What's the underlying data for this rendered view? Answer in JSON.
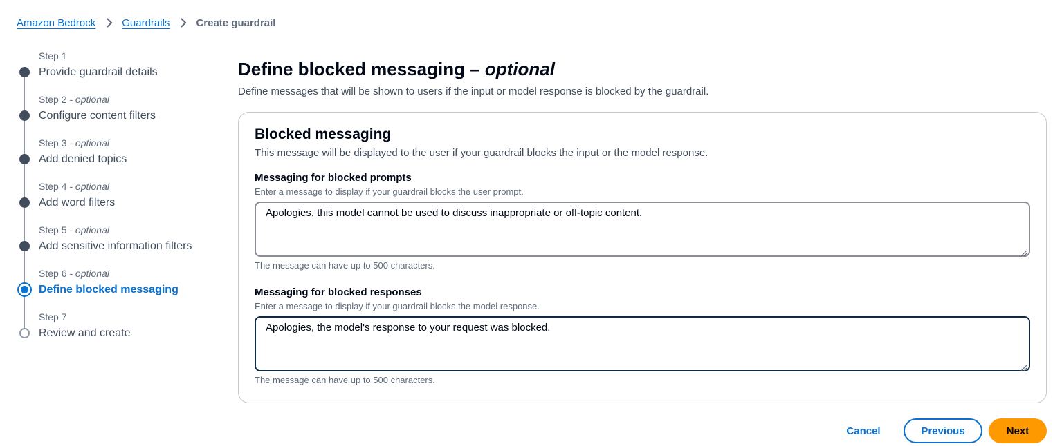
{
  "breadcrumb": {
    "items": [
      {
        "label": "Amazon Bedrock"
      },
      {
        "label": "Guardrails"
      }
    ],
    "current": "Create guardrail"
  },
  "steps": [
    {
      "number": "Step 1",
      "optional": "",
      "title": "Provide guardrail details",
      "state": "done"
    },
    {
      "number": "Step 2",
      "optional": " - optional",
      "title": "Configure content filters",
      "state": "done"
    },
    {
      "number": "Step 3",
      "optional": " - optional",
      "title": "Add denied topics",
      "state": "done"
    },
    {
      "number": "Step 4",
      "optional": " - optional",
      "title": "Add word filters",
      "state": "done"
    },
    {
      "number": "Step 5",
      "optional": " - optional",
      "title": "Add sensitive information filters",
      "state": "done"
    },
    {
      "number": "Step 6",
      "optional": " - optional",
      "title": "Define blocked messaging",
      "state": "active"
    },
    {
      "number": "Step 7",
      "optional": "",
      "title": "Review and create",
      "state": "todo"
    }
  ],
  "page": {
    "title": "Define blocked messaging",
    "title_dash": " – ",
    "title_optional": "optional",
    "description": "Define messages that will be shown to users if the input or model response is blocked by the guardrail."
  },
  "panel": {
    "title": "Blocked messaging",
    "description": "This message will be displayed to the user if your guardrail blocks the input or the model response.",
    "prompts": {
      "label": "Messaging for blocked prompts",
      "description": "Enter a message to display if your guardrail blocks the user prompt.",
      "value": "Apologies, this model cannot be used to discuss inappropriate or off-topic content.",
      "hint": "The message can have up to 500 characters."
    },
    "responses": {
      "label": "Messaging for blocked responses",
      "description": "Enter a message to display if your guardrail blocks the model response.",
      "value": "Apologies, the model's response to your request was blocked.",
      "hint": "The message can have up to 500 characters."
    }
  },
  "footer": {
    "cancel": "Cancel",
    "previous": "Previous",
    "next": "Next"
  },
  "colors": {
    "link": "#0972d3",
    "primary_button": "#ff9900",
    "text": "#000716",
    "muted": "#5f6b7a"
  }
}
